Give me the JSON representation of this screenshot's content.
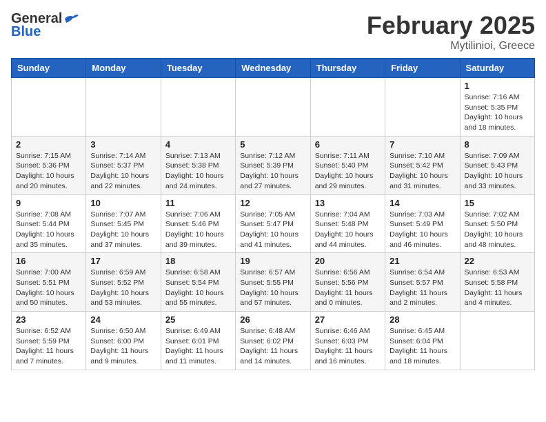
{
  "header": {
    "logo_general": "General",
    "logo_blue": "Blue",
    "month": "February 2025",
    "location": "Mytilinioi, Greece"
  },
  "days_of_week": [
    "Sunday",
    "Monday",
    "Tuesday",
    "Wednesday",
    "Thursday",
    "Friday",
    "Saturday"
  ],
  "weeks": [
    [
      {
        "day": "",
        "info": ""
      },
      {
        "day": "",
        "info": ""
      },
      {
        "day": "",
        "info": ""
      },
      {
        "day": "",
        "info": ""
      },
      {
        "day": "",
        "info": ""
      },
      {
        "day": "",
        "info": ""
      },
      {
        "day": "1",
        "info": "Sunrise: 7:16 AM\nSunset: 5:35 PM\nDaylight: 10 hours and 18 minutes."
      }
    ],
    [
      {
        "day": "2",
        "info": "Sunrise: 7:15 AM\nSunset: 5:36 PM\nDaylight: 10 hours and 20 minutes."
      },
      {
        "day": "3",
        "info": "Sunrise: 7:14 AM\nSunset: 5:37 PM\nDaylight: 10 hours and 22 minutes."
      },
      {
        "day": "4",
        "info": "Sunrise: 7:13 AM\nSunset: 5:38 PM\nDaylight: 10 hours and 24 minutes."
      },
      {
        "day": "5",
        "info": "Sunrise: 7:12 AM\nSunset: 5:39 PM\nDaylight: 10 hours and 27 minutes."
      },
      {
        "day": "6",
        "info": "Sunrise: 7:11 AM\nSunset: 5:40 PM\nDaylight: 10 hours and 29 minutes."
      },
      {
        "day": "7",
        "info": "Sunrise: 7:10 AM\nSunset: 5:42 PM\nDaylight: 10 hours and 31 minutes."
      },
      {
        "day": "8",
        "info": "Sunrise: 7:09 AM\nSunset: 5:43 PM\nDaylight: 10 hours and 33 minutes."
      }
    ],
    [
      {
        "day": "9",
        "info": "Sunrise: 7:08 AM\nSunset: 5:44 PM\nDaylight: 10 hours and 35 minutes."
      },
      {
        "day": "10",
        "info": "Sunrise: 7:07 AM\nSunset: 5:45 PM\nDaylight: 10 hours and 37 minutes."
      },
      {
        "day": "11",
        "info": "Sunrise: 7:06 AM\nSunset: 5:46 PM\nDaylight: 10 hours and 39 minutes."
      },
      {
        "day": "12",
        "info": "Sunrise: 7:05 AM\nSunset: 5:47 PM\nDaylight: 10 hours and 41 minutes."
      },
      {
        "day": "13",
        "info": "Sunrise: 7:04 AM\nSunset: 5:48 PM\nDaylight: 10 hours and 44 minutes."
      },
      {
        "day": "14",
        "info": "Sunrise: 7:03 AM\nSunset: 5:49 PM\nDaylight: 10 hours and 46 minutes."
      },
      {
        "day": "15",
        "info": "Sunrise: 7:02 AM\nSunset: 5:50 PM\nDaylight: 10 hours and 48 minutes."
      }
    ],
    [
      {
        "day": "16",
        "info": "Sunrise: 7:00 AM\nSunset: 5:51 PM\nDaylight: 10 hours and 50 minutes."
      },
      {
        "day": "17",
        "info": "Sunrise: 6:59 AM\nSunset: 5:52 PM\nDaylight: 10 hours and 53 minutes."
      },
      {
        "day": "18",
        "info": "Sunrise: 6:58 AM\nSunset: 5:54 PM\nDaylight: 10 hours and 55 minutes."
      },
      {
        "day": "19",
        "info": "Sunrise: 6:57 AM\nSunset: 5:55 PM\nDaylight: 10 hours and 57 minutes."
      },
      {
        "day": "20",
        "info": "Sunrise: 6:56 AM\nSunset: 5:56 PM\nDaylight: 11 hours and 0 minutes."
      },
      {
        "day": "21",
        "info": "Sunrise: 6:54 AM\nSunset: 5:57 PM\nDaylight: 11 hours and 2 minutes."
      },
      {
        "day": "22",
        "info": "Sunrise: 6:53 AM\nSunset: 5:58 PM\nDaylight: 11 hours and 4 minutes."
      }
    ],
    [
      {
        "day": "23",
        "info": "Sunrise: 6:52 AM\nSunset: 5:59 PM\nDaylight: 11 hours and 7 minutes."
      },
      {
        "day": "24",
        "info": "Sunrise: 6:50 AM\nSunset: 6:00 PM\nDaylight: 11 hours and 9 minutes."
      },
      {
        "day": "25",
        "info": "Sunrise: 6:49 AM\nSunset: 6:01 PM\nDaylight: 11 hours and 11 minutes."
      },
      {
        "day": "26",
        "info": "Sunrise: 6:48 AM\nSunset: 6:02 PM\nDaylight: 11 hours and 14 minutes."
      },
      {
        "day": "27",
        "info": "Sunrise: 6:46 AM\nSunset: 6:03 PM\nDaylight: 11 hours and 16 minutes."
      },
      {
        "day": "28",
        "info": "Sunrise: 6:45 AM\nSunset: 6:04 PM\nDaylight: 11 hours and 18 minutes."
      },
      {
        "day": "",
        "info": ""
      }
    ]
  ]
}
